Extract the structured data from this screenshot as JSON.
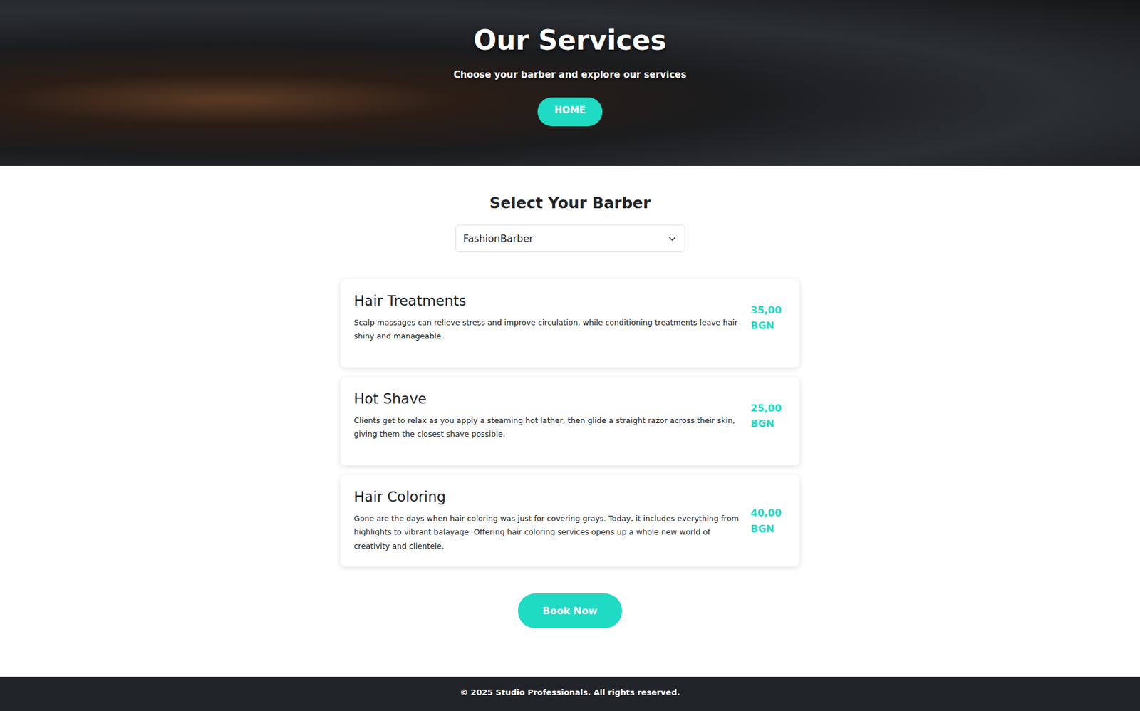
{
  "hero": {
    "title": "Our Services",
    "subtitle": "Choose your barber and explore our services",
    "home_button": "HOME"
  },
  "barber_picker": {
    "heading": "Select Your Barber",
    "selected_value": "FashionBarber"
  },
  "services": [
    {
      "name": "Hair Treatments",
      "description": "Scalp massages can relieve stress and improve circulation, while conditioning treatments leave hair shiny and manageable.",
      "price": "35,00 BGN"
    },
    {
      "name": "Hot Shave",
      "description": "Clients get to relax as you apply a steaming hot lather, then glide a straight razor across their skin, giving them the closest shave possible.",
      "price": "25,00 BGN"
    },
    {
      "name": "Hair Coloring",
      "description": "Gone are the days when hair coloring was just for covering grays. Today, it includes everything from highlights to vibrant balayage. Offering hair coloring services opens up a whole new world of creativity and clientele.",
      "price": "40,00 BGN"
    }
  ],
  "book_button": "Book Now",
  "footer": {
    "text": "© 2025 Studio Professionals. All rights reserved."
  }
}
